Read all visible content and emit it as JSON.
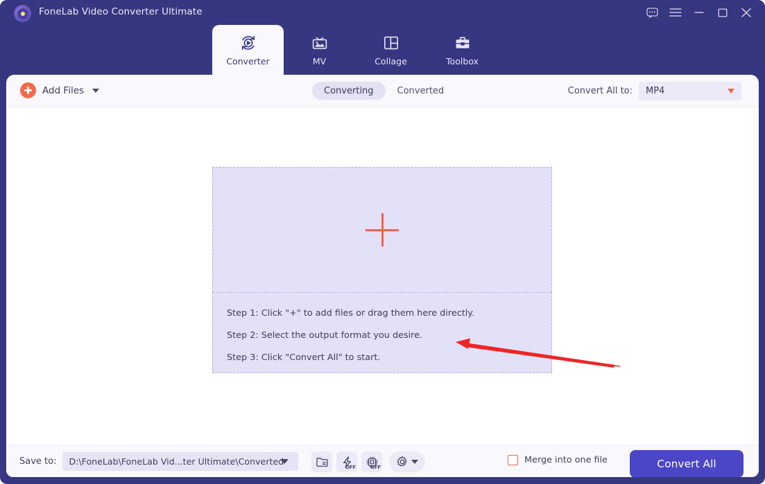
{
  "window": {
    "title": "FoneLab Video Converter Ultimate",
    "logo_icon": "app-logo-disc-icon",
    "controls": [
      {
        "name": "feedback-button",
        "icon": "chat-bubble-icon"
      },
      {
        "name": "menu-button",
        "icon": "hamburger-menu-icon"
      },
      {
        "name": "minimize-button",
        "icon": "minimize-icon"
      },
      {
        "name": "maximize-button",
        "icon": "maximize-icon"
      },
      {
        "name": "close-button",
        "icon": "close-icon"
      }
    ]
  },
  "nav": {
    "tabs": [
      {
        "label": "Converter",
        "icon": "converter-refresh-play-icon",
        "active": true
      },
      {
        "label": "MV",
        "icon": "mv-tv-image-icon",
        "active": false
      },
      {
        "label": "Collage",
        "icon": "collage-grid-icon",
        "active": false
      },
      {
        "label": "Toolbox",
        "icon": "toolbox-briefcase-icon",
        "active": false
      }
    ]
  },
  "toolbar": {
    "add_files_label": "Add Files",
    "add_files_icon": "plus-circle-icon",
    "add_files_caret_icon": "chevron-down-icon",
    "segments": [
      {
        "label": "Converting",
        "active": true
      },
      {
        "label": "Converted",
        "active": false
      }
    ],
    "convert_all_to_label": "Convert All to:",
    "convert_all_to_value": "MP4",
    "convert_all_to_caret_icon": "caret-down-icon"
  },
  "stage": {
    "dropzone": {
      "plus_icon": "large-plus-icon",
      "steps": [
        "Step 1: Click \"+\" to add files or drag them here directly.",
        "Step 2: Select the output format you desire.",
        "Step 3: Click \"Convert All\" to start."
      ]
    },
    "annotation": {
      "type": "red-arrow",
      "color": "#ee2626",
      "points_to": "large-plus-icon"
    }
  },
  "bottom": {
    "save_to_label": "Save to:",
    "save_to_path": "D:\\FoneLab\\FoneLab Vid...ter Ultimate\\Converted",
    "save_to_caret_icon": "caret-down-icon",
    "icon_buttons": [
      {
        "name": "open-folder-button",
        "icon": "folder-icon",
        "badge": ""
      },
      {
        "name": "hardware-acceleration-button",
        "icon": "lightning-bolt-icon",
        "badge": "OFF"
      },
      {
        "name": "gpu-acceleration-button",
        "icon": "cpu-chip-icon",
        "badge": "OFF"
      },
      {
        "name": "preferences-button",
        "icon": "gear-icon",
        "badge": ""
      }
    ],
    "merge_label": "Merge into one file",
    "merge_checked": false,
    "convert_all_label": "Convert All"
  },
  "colors": {
    "window_chrome": "#373680",
    "panel_bg": "#f8f8fd",
    "accent_orange": "#f26a4b",
    "accent_blue": "#4a46c6",
    "dropzone_bg": "#e3e1f8",
    "annotation_red": "#ee2626"
  }
}
